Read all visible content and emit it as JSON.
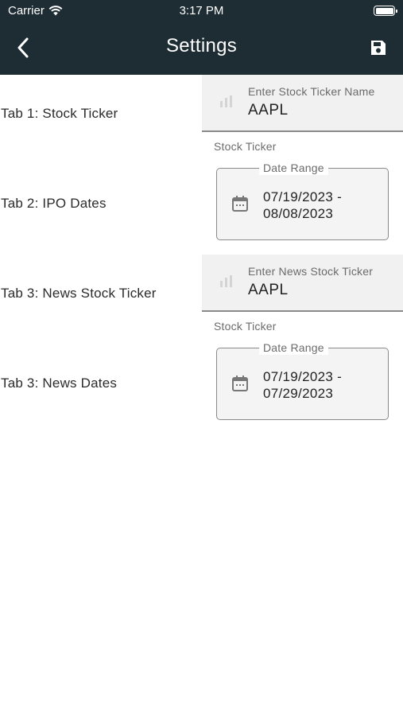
{
  "status_bar": {
    "carrier": "Carrier",
    "time": "3:17 PM"
  },
  "header": {
    "title": "Settings",
    "back_icon": "chevron-left-icon",
    "save_icon": "save-icon"
  },
  "rows": [
    {
      "label": "Tab 1: Stock Ticker",
      "field_label": "Enter Stock Ticker Name",
      "value": "AAPL",
      "helper": "Stock Ticker"
    },
    {
      "label": "Tab 2: IPO Dates",
      "legend": "Date Range",
      "value": "07/19/2023 - 08/08/2023"
    },
    {
      "label": "Tab 3: News Stock Ticker",
      "field_label": "Enter News Stock Ticker",
      "value": "AAPL",
      "helper": "Stock Ticker"
    },
    {
      "label": "Tab 3: News Dates",
      "legend": "Date Range",
      "value": "07/19/2023 - 07/29/2023"
    }
  ],
  "colors": {
    "app_bar": "#1d2d33",
    "field_fill": "#f1f1f1",
    "outline": "#8a8a8a"
  }
}
